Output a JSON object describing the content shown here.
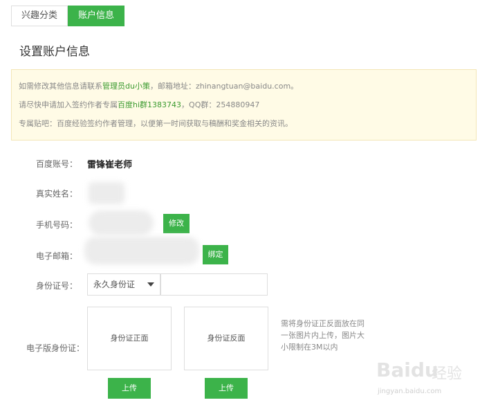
{
  "tabs": [
    {
      "label": "兴趣分类",
      "active": false
    },
    {
      "label": "账户信息",
      "active": true
    }
  ],
  "page_title": "设置账户信息",
  "notice": {
    "line1": {
      "pre": "如需修改其他信息请联系",
      "link": "管理员du小策",
      "post": "，邮箱地址：zhinangtuan@baidu.com。"
    },
    "line2": {
      "pre": "请尽快申请加入签约作者专属",
      "link": "百度hi群1383743",
      "post": "，QQ群：254880947"
    },
    "line3": "专属贴吧：百度经验签约作者管理，以便第一时间获取与稿酬和奖金相关的资讯。"
  },
  "form": {
    "account_label": "百度账号：",
    "account_value": "雷锋崔老师",
    "realname_label": "真实姓名：",
    "phone_label": "手机号码：",
    "phone_button": "修改",
    "email_label": "电子邮箱：",
    "email_button": "绑定",
    "idcard_label": "身份证号：",
    "idcard_type_selected": "永久身份证",
    "idcard_input_placeholder": "",
    "eid_label": "电子版身份证：",
    "front_label": "身份证正面",
    "back_label": "身份证反面",
    "upload_label": "上传",
    "hint": "需将身份证正反面放在同一张图片内上传，图片大小限制在3M以内"
  },
  "watermark": {
    "logo": "Baidu",
    "cn": "经验",
    "url": "jingyan.baidu.com"
  },
  "colors": {
    "accent": "#3cb34a",
    "notice_bg": "#fffbe6",
    "link": "#3a9a2e"
  }
}
